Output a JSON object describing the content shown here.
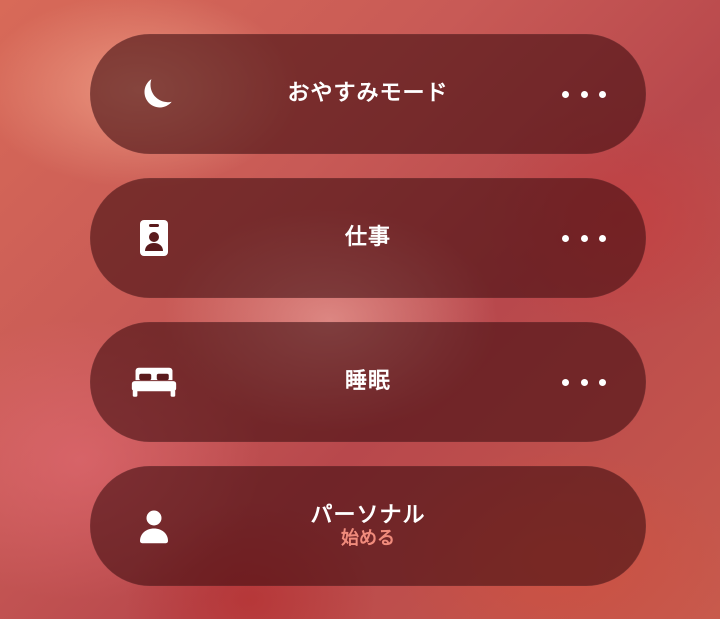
{
  "focus_modes": [
    {
      "label": "おやすみモード",
      "icon": "moon-icon",
      "has_more": true
    },
    {
      "label": "仕事",
      "icon": "id-badge-icon",
      "has_more": true
    },
    {
      "label": "睡眠",
      "icon": "bed-icon",
      "has_more": true
    },
    {
      "label": "パーソナル",
      "sublabel": "始める",
      "icon": "person-icon",
      "has_more": false
    }
  ],
  "colors": {
    "tile_background": "#3c0a0e",
    "text": "#ffffff",
    "sublabel": "#f08b7c"
  }
}
